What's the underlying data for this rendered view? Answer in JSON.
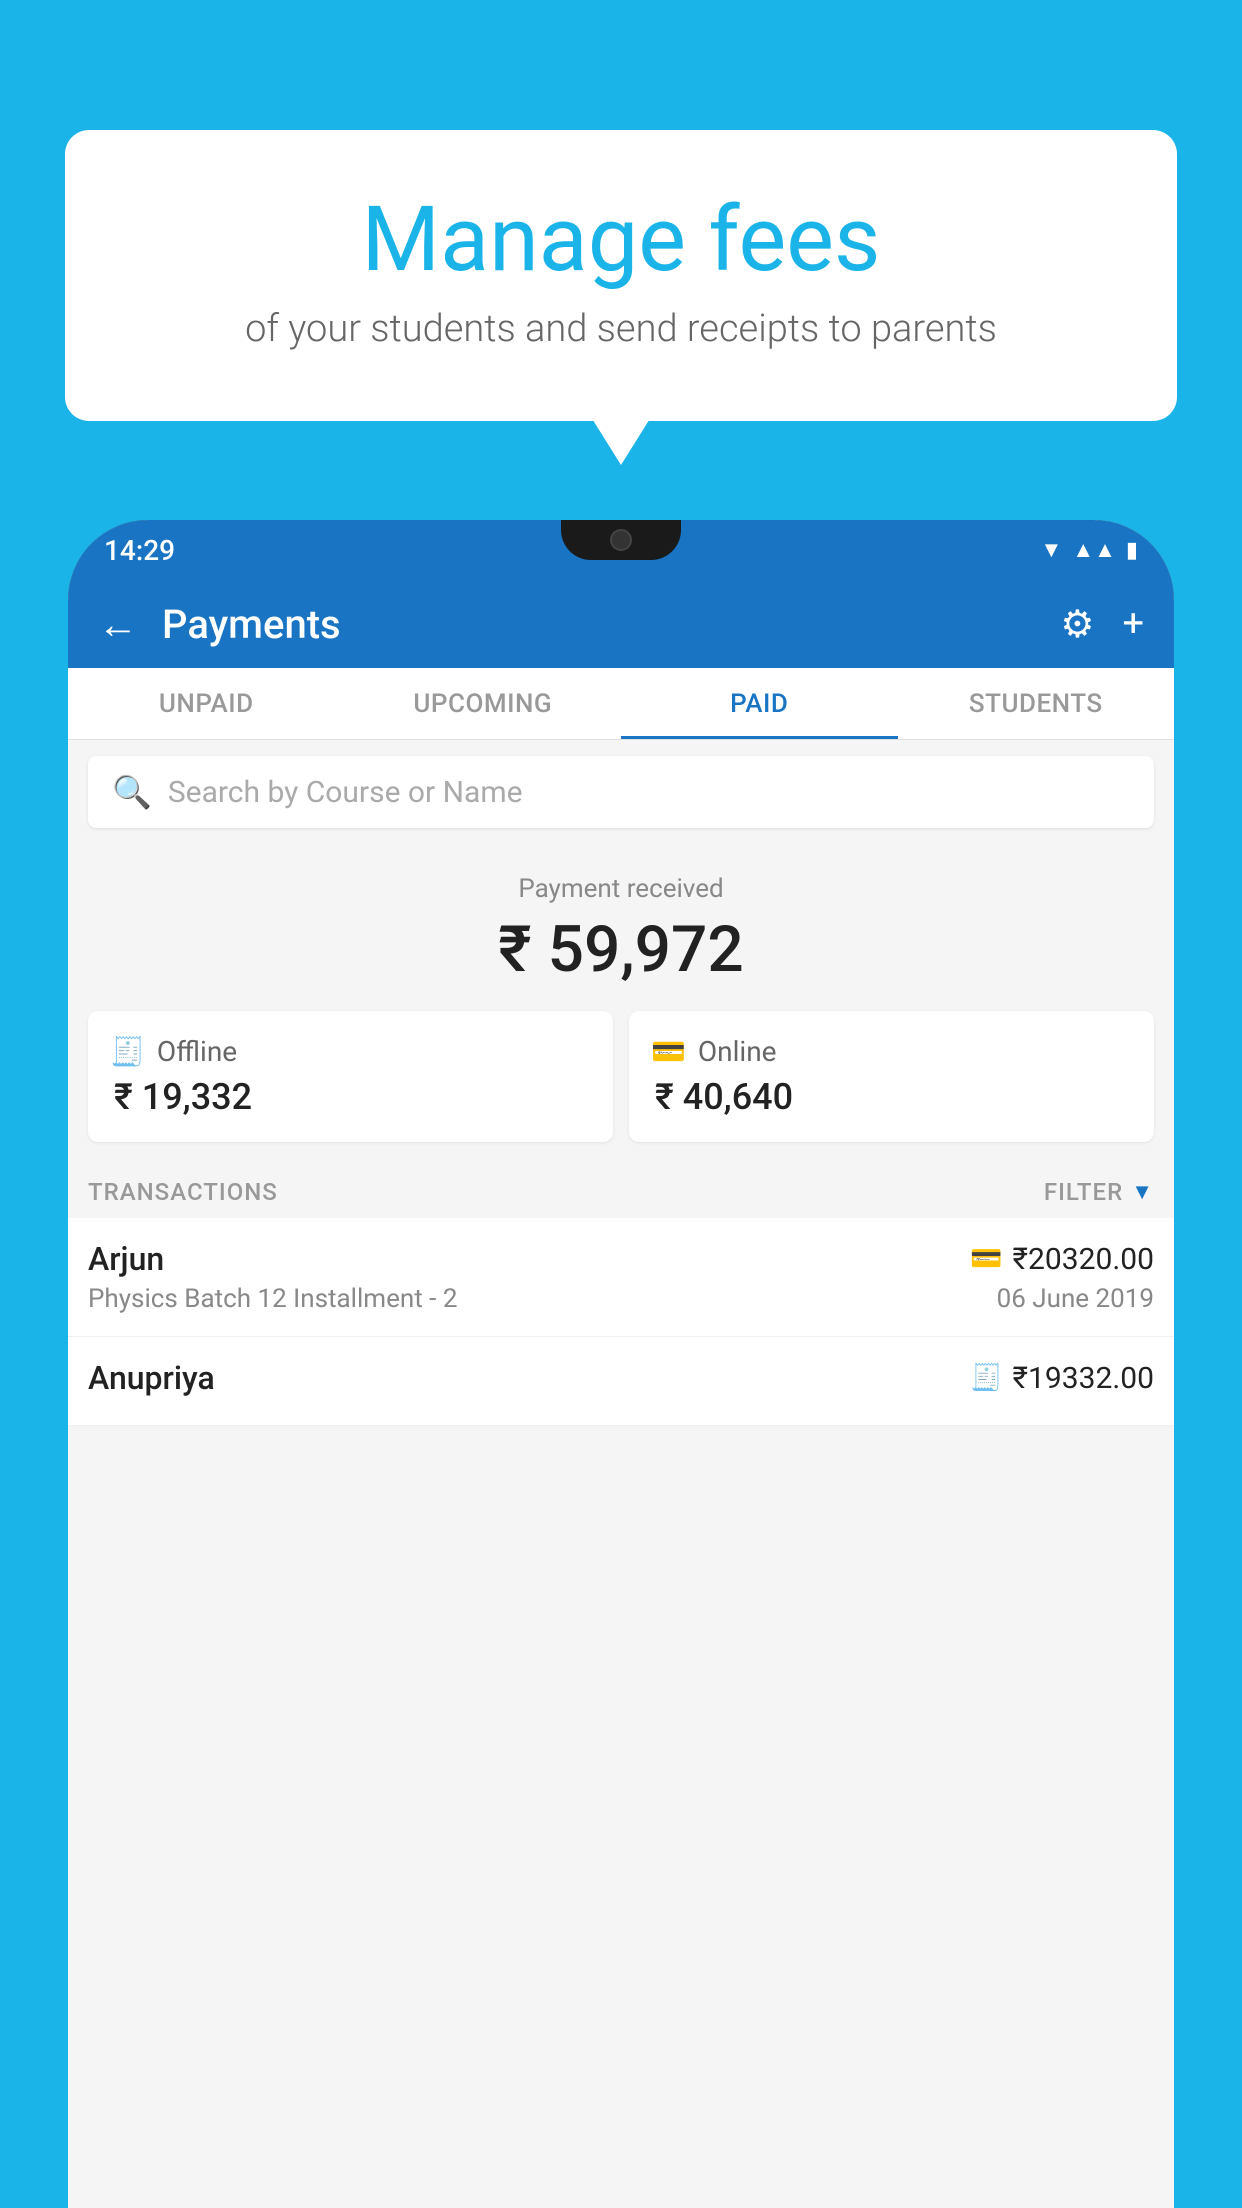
{
  "page": {
    "background_color": "#1ab4e8"
  },
  "bubble": {
    "title": "Manage fees",
    "subtitle": "of your students and send receipts to parents"
  },
  "status_bar": {
    "time": "14:29",
    "icons": [
      "wifi",
      "signal",
      "battery"
    ]
  },
  "app_bar": {
    "title": "Payments",
    "back_icon": "←",
    "settings_icon": "⚙",
    "add_icon": "+"
  },
  "tabs": [
    {
      "label": "UNPAID",
      "active": false
    },
    {
      "label": "UPCOMING",
      "active": false
    },
    {
      "label": "PAID",
      "active": true
    },
    {
      "label": "STUDENTS",
      "active": false
    }
  ],
  "search": {
    "placeholder": "Search by Course or Name"
  },
  "payment_summary": {
    "label": "Payment received",
    "amount": "₹ 59,972",
    "offline": {
      "label": "Offline",
      "amount": "₹ 19,332"
    },
    "online": {
      "label": "Online",
      "amount": "₹ 40,640"
    }
  },
  "transactions": {
    "header": "TRANSACTIONS",
    "filter": "FILTER",
    "rows": [
      {
        "name": "Arjun",
        "description": "Physics Batch 12 Installment - 2",
        "amount": "₹20320.00",
        "date": "06 June 2019",
        "payment_type": "online"
      },
      {
        "name": "Anupriya",
        "description": "",
        "amount": "₹19332.00",
        "date": "",
        "payment_type": "offline"
      }
    ]
  }
}
